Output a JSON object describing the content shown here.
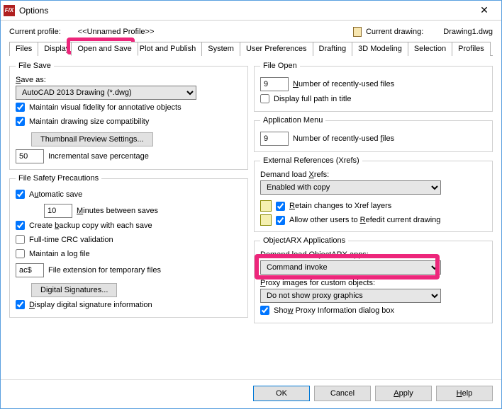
{
  "window": {
    "title": "Options"
  },
  "profile": {
    "label": "Current profile:",
    "name": "<<Unnamed Profile>>",
    "drawing_label": "Current drawing:",
    "drawing_name": "Drawing1.dwg"
  },
  "tabs": [
    "Files",
    "Display",
    "Open and Save",
    "Plot and Publish",
    "System",
    "User Preferences",
    "Drafting",
    "3D Modeling",
    "Selection",
    "Profiles"
  ],
  "file_save": {
    "legend": "File Save",
    "save_as_label": "Save as:",
    "format": "AutoCAD 2013 Drawing (*.dwg)",
    "maintain_fidelity": "Maintain visual fidelity for annotative objects",
    "maintain_compat": "Maintain drawing size compatibility",
    "thumb_btn": "Thumbnail Preview Settings...",
    "incr_value": "50",
    "incr_label": "Incremental save percentage"
  },
  "safety": {
    "legend": "File Safety Precautions",
    "autosave": "Automatic save",
    "minutes_value": "10",
    "minutes_label": "Minutes between saves",
    "backup": "Create backup copy with each save",
    "crc": "Full-time CRC validation",
    "logfile": "Maintain a log file",
    "ext_value": "ac$",
    "ext_label": "File extension for temporary files",
    "sig_btn": "Digital Signatures...",
    "display_sig": "Display digital signature information"
  },
  "file_open": {
    "legend": "File Open",
    "recent_value": "9",
    "recent_label": "Number of recently-used files",
    "fullpath": "Display full path in title"
  },
  "app_menu": {
    "legend": "Application Menu",
    "recent_value": "9",
    "recent_label": "Number of recently-used files"
  },
  "xrefs": {
    "legend": "External References (Xrefs)",
    "demand_label": "Demand load Xrefs:",
    "demand_value": "Enabled with copy",
    "retain": "Retain changes to Xref layers",
    "refedit": "Allow other users to Refedit current drawing"
  },
  "arx": {
    "legend": "ObjectARX Applications",
    "demand_label": "Demand load ObjectARX apps:",
    "demand_value": "Command invoke",
    "proxy_label": "Proxy images for custom objects:",
    "proxy_value": "Do not show proxy graphics",
    "show_proxy": "Show Proxy Information dialog box"
  },
  "buttons": {
    "ok": "OK",
    "cancel": "Cancel",
    "apply": "Apply",
    "help": "Help"
  }
}
